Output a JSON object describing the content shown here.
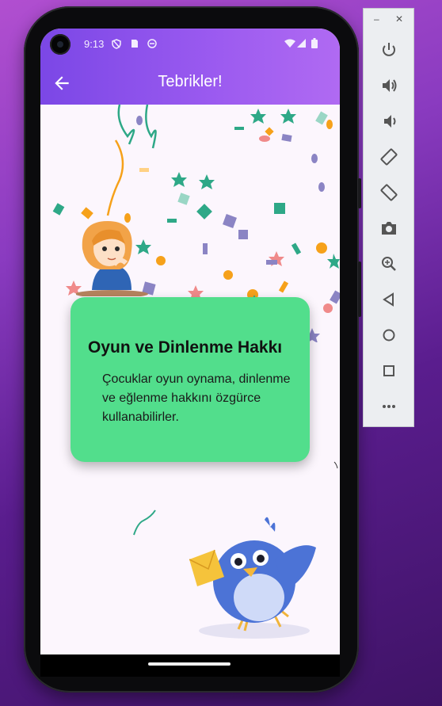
{
  "status_bar": {
    "time": "9:13"
  },
  "app_bar": {
    "title": "Tebrikler!"
  },
  "card": {
    "title": "Oyun ve Dinlenme Hakkı",
    "body": "Çocuklar oyun oynama, dinlenme ve eğlenme hakkını özgürce kullanabilirler."
  },
  "emulator_toolbar": {
    "window_controls": [
      "minimize-icon",
      "close-icon"
    ],
    "buttons": [
      "power-icon",
      "volume-up-icon",
      "volume-down-icon",
      "rotate-left-icon",
      "rotate-right-icon",
      "camera-icon",
      "zoom-icon",
      "back-icon",
      "home-icon",
      "overview-icon",
      "more-icon"
    ]
  },
  "colors": {
    "appbar_start": "#7b47e6",
    "appbar_end": "#b06af2",
    "card": "#52de8c",
    "screen_bg": "#fcf6fd"
  }
}
